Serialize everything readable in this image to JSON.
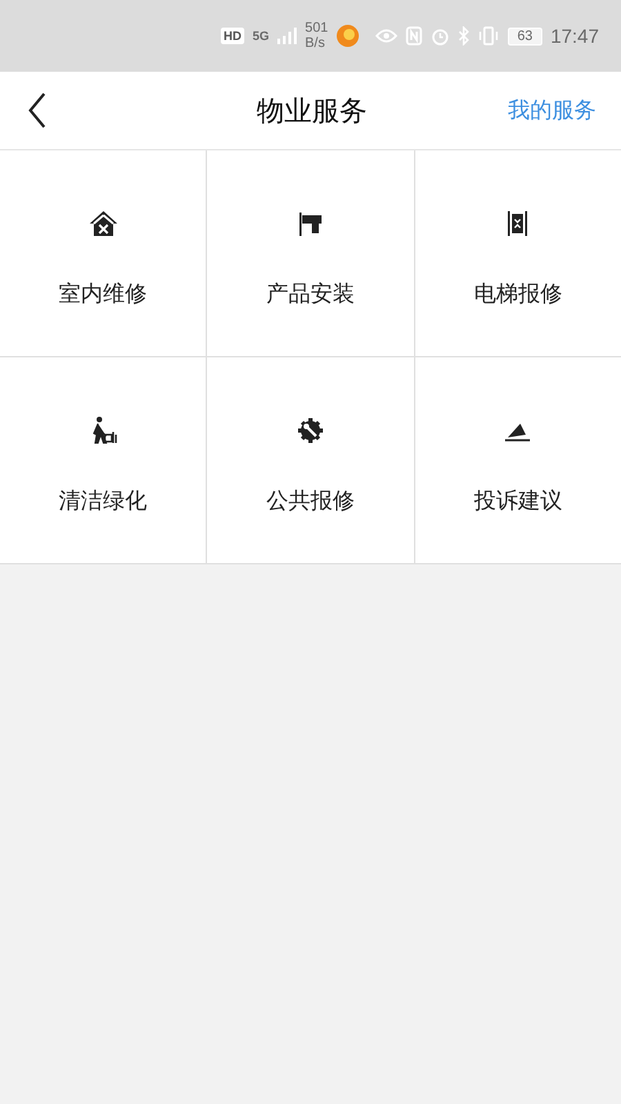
{
  "status_bar": {
    "hd": "HD",
    "network": "5G",
    "speed_value": "501",
    "speed_unit": "B/s",
    "battery": "63",
    "time": "17:47"
  },
  "header": {
    "title": "物业服务",
    "action": "我的服务"
  },
  "services": [
    {
      "label": "室内维修"
    },
    {
      "label": "产品安装"
    },
    {
      "label": "电梯报修"
    },
    {
      "label": "清洁绿化"
    },
    {
      "label": "公共报修"
    },
    {
      "label": "投诉建议"
    }
  ]
}
